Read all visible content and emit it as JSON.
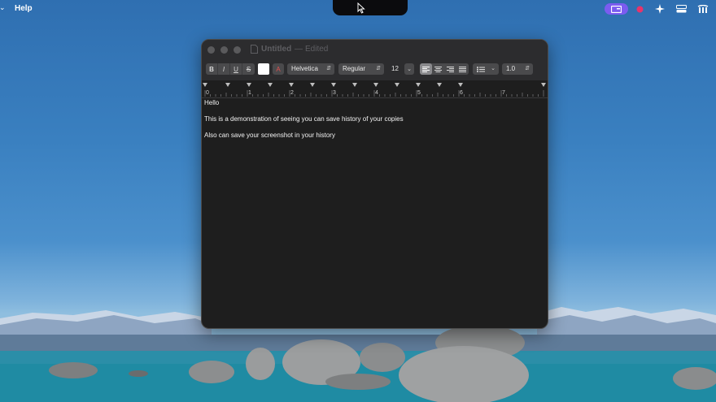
{
  "menubar": {
    "help_label": "Help",
    "status_icons": [
      "screen-capture-icon",
      "record-dot-icon",
      "sparkle-icon",
      "display-icon",
      "wifi-icon"
    ]
  },
  "window": {
    "title": "Untitled",
    "title_separator": "—",
    "edited_label": "Edited"
  },
  "toolbar": {
    "bold_label": "B",
    "italic_label": "I",
    "underline_label": "U",
    "strike_label": "S",
    "style_label": "A",
    "font_family": "Helvetica",
    "font_style": "Regular",
    "font_size": "12",
    "line_spacing": "1.0"
  },
  "ruler": {
    "numbers": [
      "0",
      "1",
      "2",
      "3",
      "4",
      "5",
      "6",
      "7"
    ]
  },
  "document": {
    "lines": [
      "Hello",
      "This is a demonstration of seeing you can save history of your copies",
      "Also can save your screenshot in your history"
    ]
  },
  "colors": {
    "window_bg": "#1e1e1e",
    "text_color": "#ffffff",
    "accent_purple": "#7b5cf0",
    "record_pink": "#e8336b"
  }
}
